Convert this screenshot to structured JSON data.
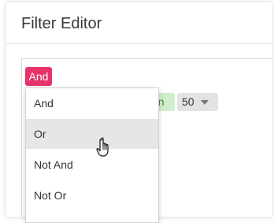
{
  "dialog": {
    "title": "Filter Editor"
  },
  "filter": {
    "group_operator": "And",
    "condition_operator_visible": "an",
    "condition_value": "50"
  },
  "menu": {
    "items": [
      {
        "label": "And"
      },
      {
        "label": "Or"
      },
      {
        "label": "Not And"
      },
      {
        "label": "Not Or"
      }
    ],
    "hovered_index": 1
  },
  "colors": {
    "group_operator_bg": "#e8336a",
    "operator_chip_bg": "#cfeecd",
    "value_chip_bg": "#e3e3e3",
    "menu_hover_bg": "#e6e6e6"
  },
  "icons": {
    "cursor": "hand-pointer-icon",
    "value_dropdown": "caret-down-icon"
  }
}
